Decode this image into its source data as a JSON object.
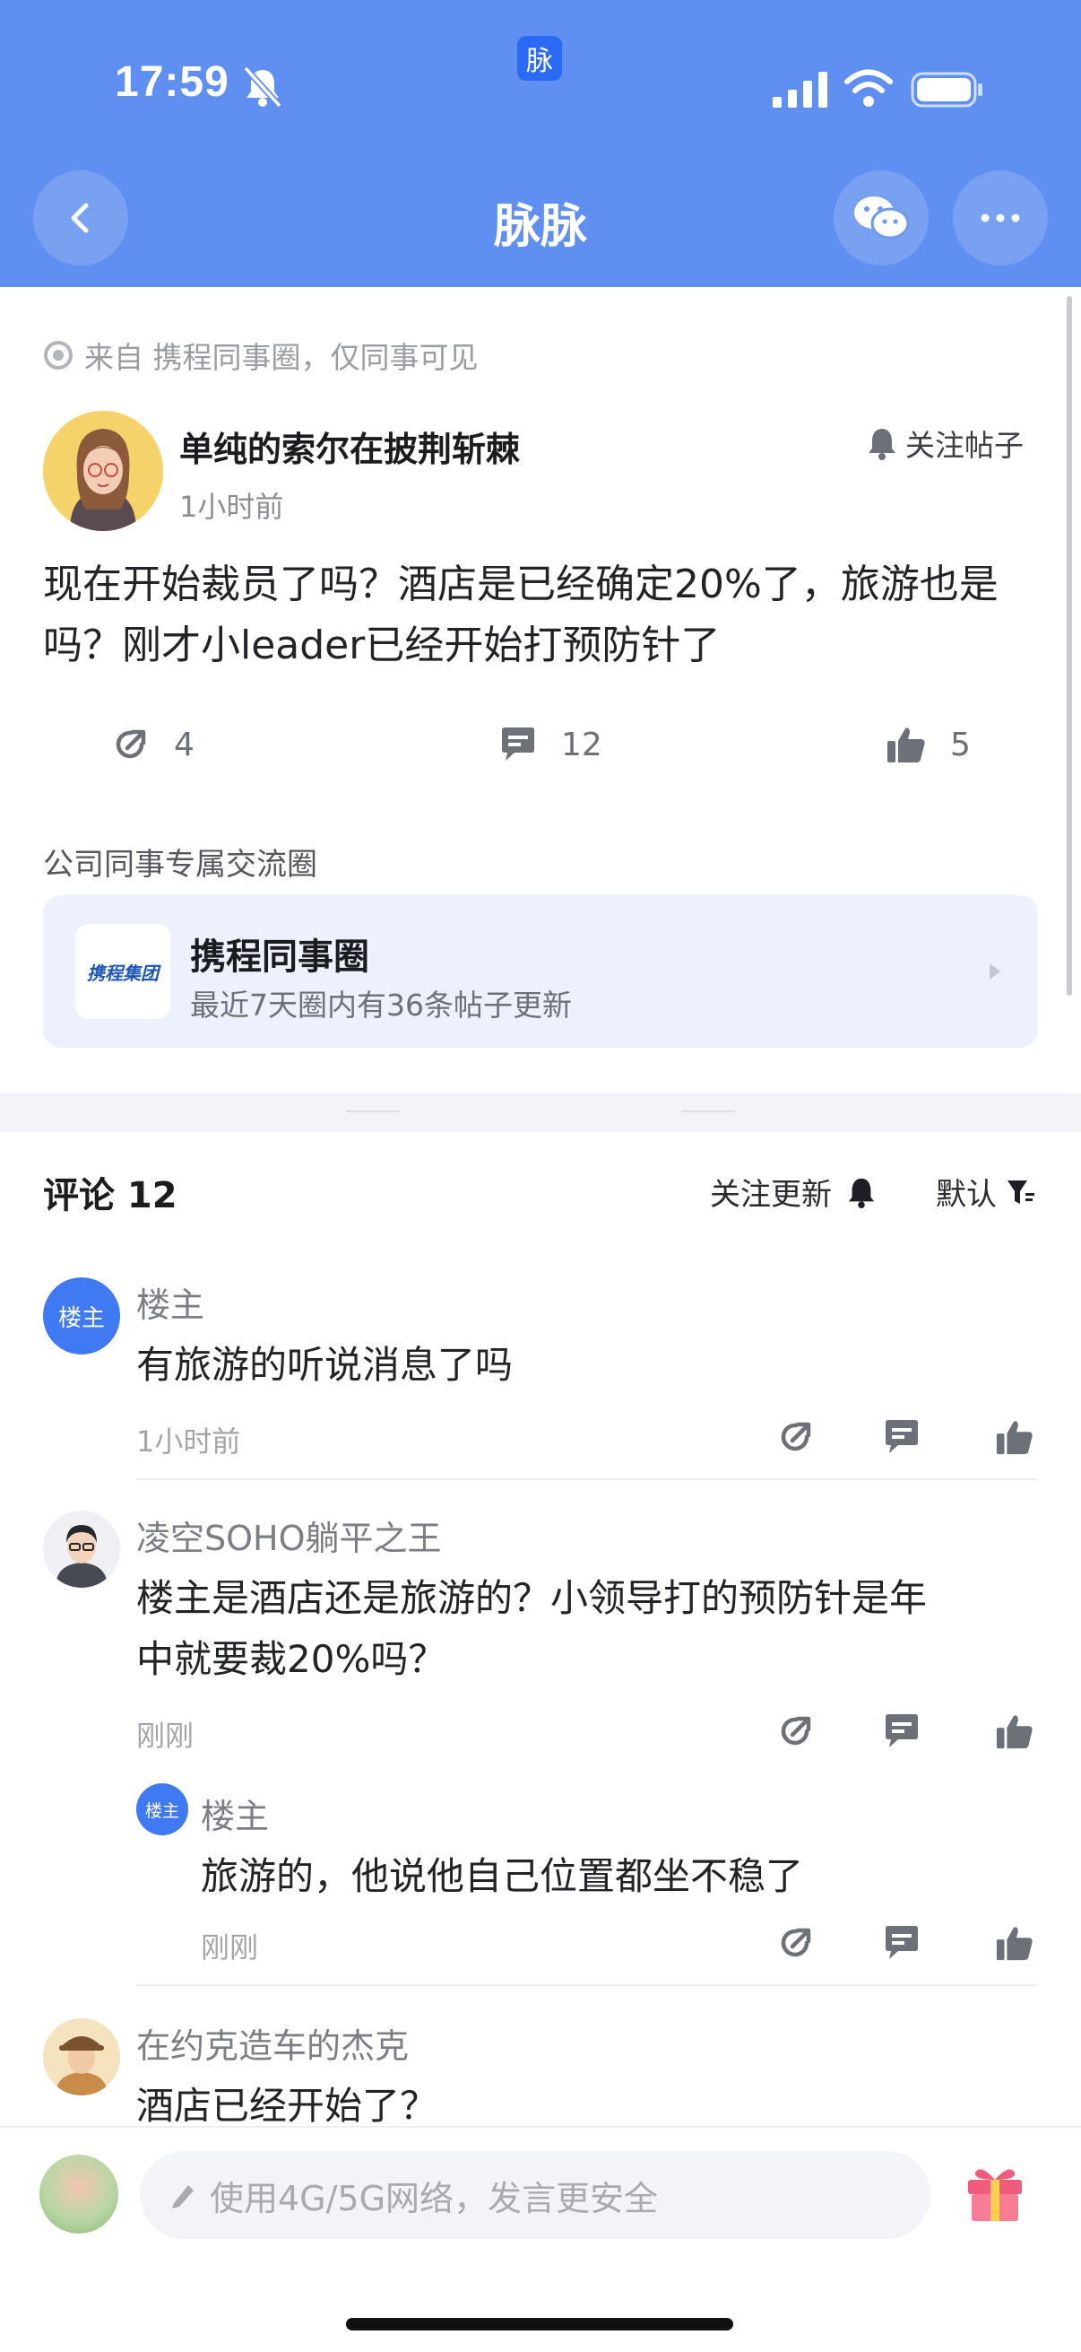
{
  "status_bar": {
    "time": "17:59",
    "app_badge": "脉"
  },
  "nav": {
    "title": "脉脉"
  },
  "post": {
    "source": "来自 携程同事圈，仅同事可见",
    "author": "单纯的索尔在披荆斩棘",
    "time": "1小时前",
    "follow_label": "关注帖子",
    "body": "现在开始裁员了吗？酒店是已经确定20%了，旅游也是吗？刚才小leader已经开始打预防针了",
    "shares": "4",
    "comments": "12",
    "likes": "5"
  },
  "circle": {
    "label": "公司同事专属交流圈",
    "logo_text": "携程集团",
    "name": "携程同事圈",
    "desc": "最近7天圈内有36条帖子更新"
  },
  "comments_header": {
    "title": "评论 12",
    "follow_update": "关注更新",
    "sort": "默认"
  },
  "comments": [
    {
      "badge": "楼主",
      "name": "楼主",
      "text": "有旅游的听说消息了吗",
      "time": "1小时前"
    },
    {
      "name": "凌空SOHO躺平之王",
      "text_line1": "楼主是酒店还是旅游的？小领导打的预防针是年",
      "text_line2": "中就要裁20%吗？",
      "time": "刚刚"
    },
    {
      "badge": "楼主",
      "name": "楼主",
      "text": "旅游的，他说他自己位置都坐不稳了",
      "time": "刚刚"
    },
    {
      "name": "在约克造车的杰克",
      "text": "酒店已经开始了？"
    }
  ],
  "footer": {
    "input_placeholder": "使用4G/5G网络，发言更安全"
  },
  "colors": {
    "header_bg": "#5f8ff0",
    "accent": "#3f7af3",
    "card_bg": "#eef1fd"
  }
}
